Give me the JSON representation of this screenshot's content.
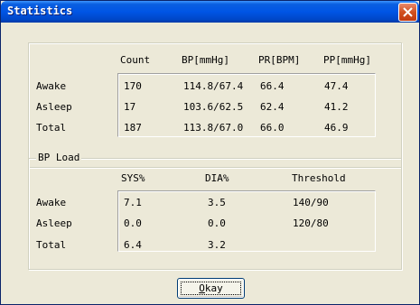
{
  "window": {
    "title": "Statistics"
  },
  "stats": {
    "headers": [
      "Count",
      "BP[mmHg]",
      "PR[BPM]",
      "PP[mmHg]"
    ],
    "rows": [
      {
        "label": "Awake",
        "values": [
          "170",
          "114.8/67.4",
          "66.4",
          "47.4"
        ]
      },
      {
        "label": "Asleep",
        "values": [
          "17",
          "103.6/62.5",
          "62.4",
          "41.2"
        ]
      },
      {
        "label": "Total",
        "values": [
          "187",
          "113.8/67.0",
          "66.0",
          "46.9"
        ]
      }
    ]
  },
  "bp_load": {
    "legend": "BP Load",
    "headers": [
      "SYS%",
      "DIA%",
      "Threshold"
    ],
    "rows": [
      {
        "label": "Awake",
        "values": [
          "7.1",
          "3.5",
          "140/90"
        ]
      },
      {
        "label": "Asleep",
        "values": [
          "0.0",
          "0.0",
          "120/80"
        ]
      },
      {
        "label": "Total",
        "values": [
          "6.4",
          "3.2",
          ""
        ]
      }
    ]
  },
  "button": {
    "okay_first": "O",
    "okay_rest": "kay"
  },
  "colors": {
    "title_bar": "#0055e5",
    "face": "#ece9d8",
    "close_button": "#d1501f"
  }
}
